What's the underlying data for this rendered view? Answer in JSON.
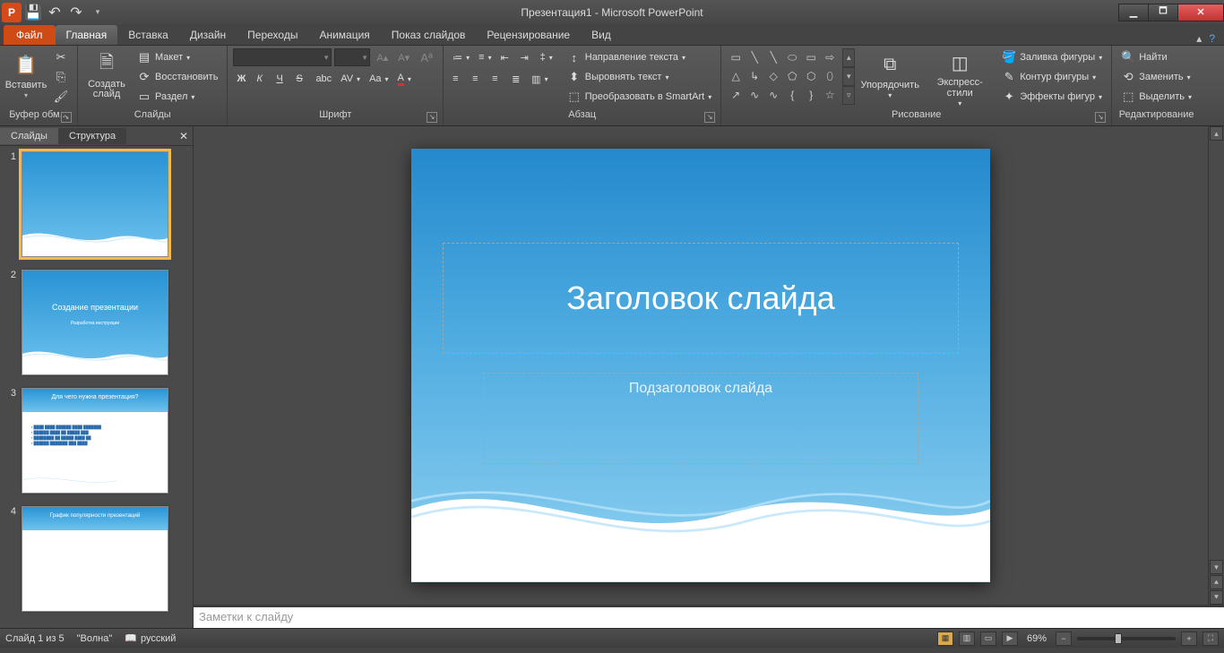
{
  "window": {
    "title": "Презентация1 - Microsoft PowerPoint"
  },
  "tabs": {
    "file": "Файл",
    "items": [
      "Главная",
      "Вставка",
      "Дизайн",
      "Переходы",
      "Анимация",
      "Показ слайдов",
      "Рецензирование",
      "Вид"
    ],
    "active_index": 0
  },
  "ribbon": {
    "clipboard": {
      "label": "Буфер обм...",
      "paste": "Вставить"
    },
    "slides": {
      "label": "Слайды",
      "new": "Создать\nслайд",
      "layout": "Макет",
      "reset": "Восстановить",
      "section": "Раздел"
    },
    "font": {
      "label": "Шрифт",
      "name": "",
      "size": ""
    },
    "paragraph": {
      "label": "Абзац",
      "textdir": "Направление текста",
      "align": "Выровнять текст",
      "smartart": "Преобразовать в SmartArt"
    },
    "drawing": {
      "label": "Рисование",
      "arrange": "Упорядочить",
      "styles": "Экспресс-стили",
      "fill": "Заливка фигуры",
      "outline": "Контур фигуры",
      "effects": "Эффекты фигур"
    },
    "editing": {
      "label": "Редактирование",
      "find": "Найти",
      "replace": "Заменить",
      "select": "Выделить"
    }
  },
  "leftpanel": {
    "tab_slides": "Слайды",
    "tab_outline": "Структура",
    "thumbs": [
      {
        "n": "1",
        "title": "",
        "sub": "",
        "selected": true
      },
      {
        "n": "2",
        "title": "Создание презентации",
        "sub": "Разработка инструкции",
        "selected": false
      },
      {
        "n": "3",
        "title": "Для чего нужна презентация?",
        "sub": "",
        "selected": false
      },
      {
        "n": "4",
        "title": "График популярности презентаций",
        "sub": "",
        "selected": false
      }
    ]
  },
  "slide": {
    "title_placeholder": "Заголовок слайда",
    "subtitle_placeholder": "Подзаголовок слайда"
  },
  "notes": {
    "placeholder": "Заметки к слайду"
  },
  "statusbar": {
    "slide_pos": "Слайд 1 из 5",
    "theme": "\"Волна\"",
    "language": "русский",
    "zoom": "69%"
  }
}
